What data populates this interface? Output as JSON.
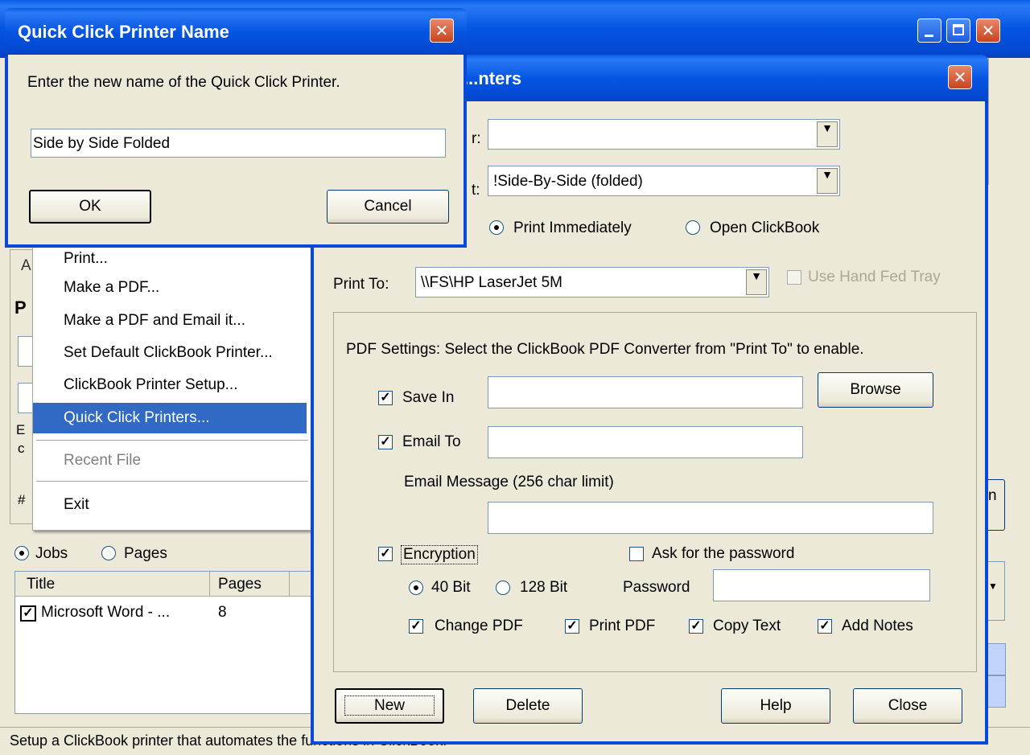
{
  "statusbar": {
    "text": "Setup a ClickBook printer that automates the functions in ClickBook."
  },
  "quick_dialog": {
    "title": "Quick Click Printer Name",
    "prompt": "Enter the new name of the Quick Click Printer.",
    "name_value": "Side by Side Folded",
    "ok_label": "OK",
    "cancel_label": "Cancel"
  },
  "menu": {
    "items": [
      {
        "label": "Print..."
      },
      {
        "label": "Make a PDF..."
      },
      {
        "label": "Make a PDF and Email it..."
      },
      {
        "label": "Set Default ClickBook Printer..."
      },
      {
        "label": "ClickBook Printer Setup..."
      },
      {
        "label": "Quick Click Printers..."
      },
      {
        "label": "Recent File"
      },
      {
        "label": "Exit"
      }
    ]
  },
  "background": {
    "letters": [
      "A",
      "P",
      "E",
      "c",
      "#"
    ],
    "view_jobs": "Jobs",
    "view_pages": "Pages",
    "table_headers": [
      "Title",
      "Pages"
    ],
    "row_title": "Microsoft Word - ...",
    "row_pages": "8"
  },
  "qc_dialog": {
    "title": "...nters",
    "printer_value": "",
    "layout_value": "!Side-By-Side (folded)",
    "label_r": "r:",
    "label_t": "t:",
    "print_immediately": "Print Immediately",
    "open_clickbook": "Open ClickBook",
    "print_to_label": "Print To:",
    "print_to_value": "\\\\FS\\HP LaserJet 5M",
    "hand_fed_tray": "Use Hand Fed Tray",
    "pdf_settings_text": "PDF Settings: Select the ClickBook PDF Converter from \"Print To\" to enable.",
    "save_in_label": "Save In",
    "browse_label": "Browse",
    "email_to_label": "Email To",
    "email_message_label": "Email Message (256 char limit)",
    "encryption_label": "Encryption",
    "ask_password_label": "Ask for the password",
    "bit40_label": "40 Bit",
    "bit128_label": "128 Bit",
    "password_label": "Password",
    "change_pdf_label": "Change PDF",
    "print_pdf_label": "Print PDF",
    "copy_text_label": "Copy Text",
    "add_notes_label": "Add Notes",
    "new_label": "New",
    "delete_label": "Delete",
    "help_label": "Help",
    "close_label": "Close"
  }
}
